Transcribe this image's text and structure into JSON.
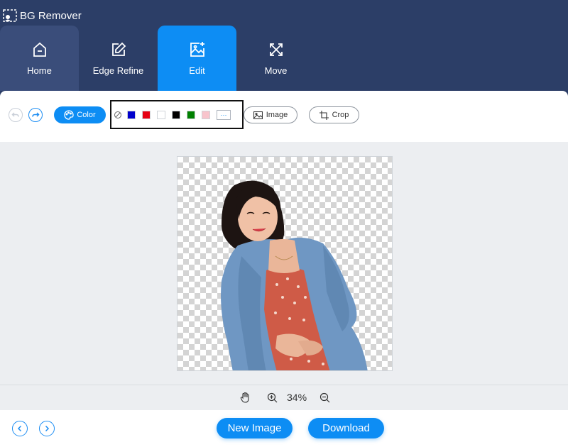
{
  "app": {
    "title": "BG Remover"
  },
  "tabs": [
    {
      "label": "Home",
      "icon": "home-icon"
    },
    {
      "label": "Edge Refine",
      "icon": "edit-square-icon"
    },
    {
      "label": "Edit",
      "icon": "image-edit-icon",
      "active": true
    },
    {
      "label": "Move",
      "icon": "move-icon"
    }
  ],
  "toolbar": {
    "color_label": "Color",
    "image_label": "Image",
    "crop_label": "Crop",
    "more_label": "···",
    "swatches": [
      "#0000cc",
      "#e60012",
      "#ffffff",
      "#000000",
      "#008000",
      "#f8c4cc"
    ]
  },
  "zoom": {
    "level": "34%"
  },
  "footer": {
    "new_image_label": "New Image",
    "download_label": "Download"
  },
  "colors": {
    "header_bg": "#2c3e67",
    "accent": "#0d8df4"
  }
}
